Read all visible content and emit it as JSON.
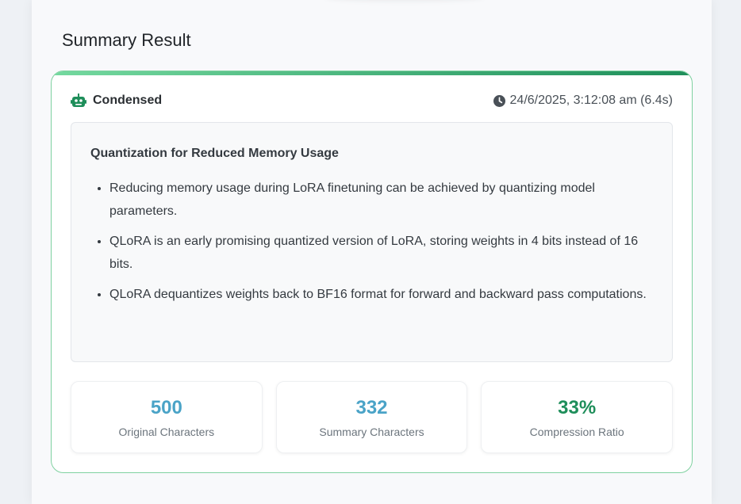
{
  "section": {
    "title": "Summary Result"
  },
  "result": {
    "mode_icon": "robot-icon",
    "mode_label": "Condensed",
    "time_icon": "clock-icon",
    "timestamp": "24/6/2025, 3:12:08 am (6.4s)",
    "accent_color": "#1e8e5a",
    "summary": {
      "heading": "Quantization for Reduced Memory Usage",
      "bullets": [
        "Reducing memory usage during LoRA finetuning can be achieved by quantizing model parameters.",
        "QLoRA is an early promising quantized version of LoRA, storing weights in 4 bits instead of 16 bits.",
        "QLoRA dequantizes weights back to BF16 format for forward and backward pass computations."
      ]
    },
    "stats": [
      {
        "value": "500",
        "label": "Original Characters",
        "color": "#4aa3c7"
      },
      {
        "value": "332",
        "label": "Summary Characters",
        "color": "#4aa3c7"
      },
      {
        "value": "33%",
        "label": "Compression Ratio",
        "color": "#1e8e5a"
      }
    ]
  }
}
